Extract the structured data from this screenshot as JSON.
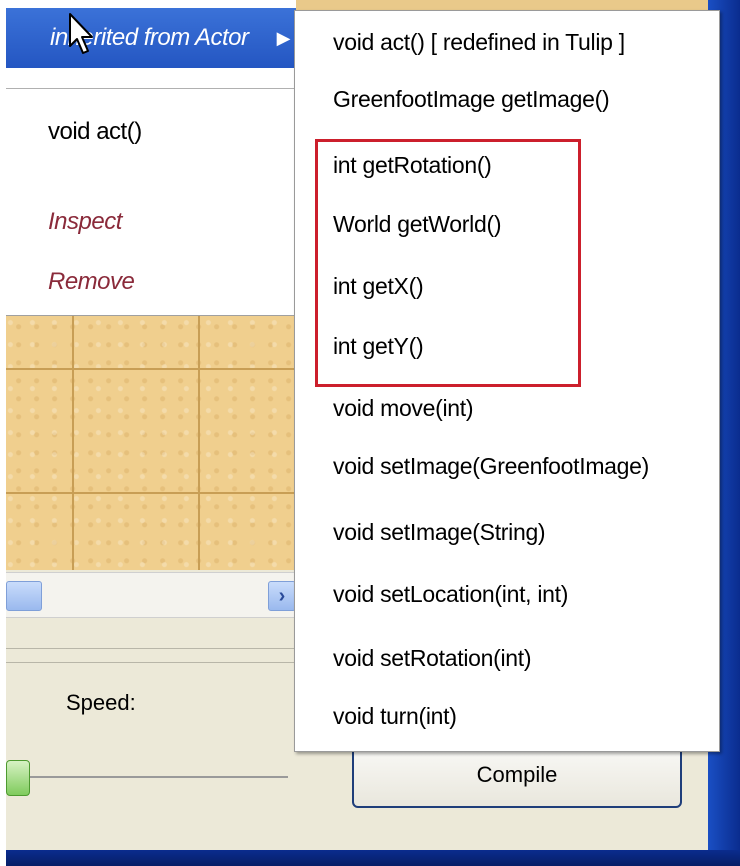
{
  "context_menu": {
    "inherited_label": "inherited from Actor",
    "items": [
      "void act()",
      "Inspect",
      "Remove"
    ]
  },
  "submenu": {
    "methods": [
      "void act()   [ redefined in Tulip ]",
      "GreenfootImage getImage()",
      "int getRotation()",
      "World getWorld()",
      "int getX()",
      "int getY()",
      "void move(int)",
      "void setImage(GreenfootImage)",
      "void setImage(String)",
      "void setLocation(int, int)",
      "void setRotation(int)",
      "void turn(int)"
    ],
    "highlighted_methods": [
      "int getRotation()",
      "World getWorld()",
      "int getX()",
      "int getY()"
    ]
  },
  "controls": {
    "speed_label": "Speed:",
    "compile_label": "Compile"
  },
  "colors": {
    "menu_highlight": "#2456c2",
    "action_text": "#8a2a3a",
    "annotation_box": "#cc1f2c",
    "world_sand": "#f0cf8e"
  },
  "icons": [
    "mouse-pointer-icon",
    "submenu-arrow-icon",
    "scroll-right-arrow-icon"
  ]
}
